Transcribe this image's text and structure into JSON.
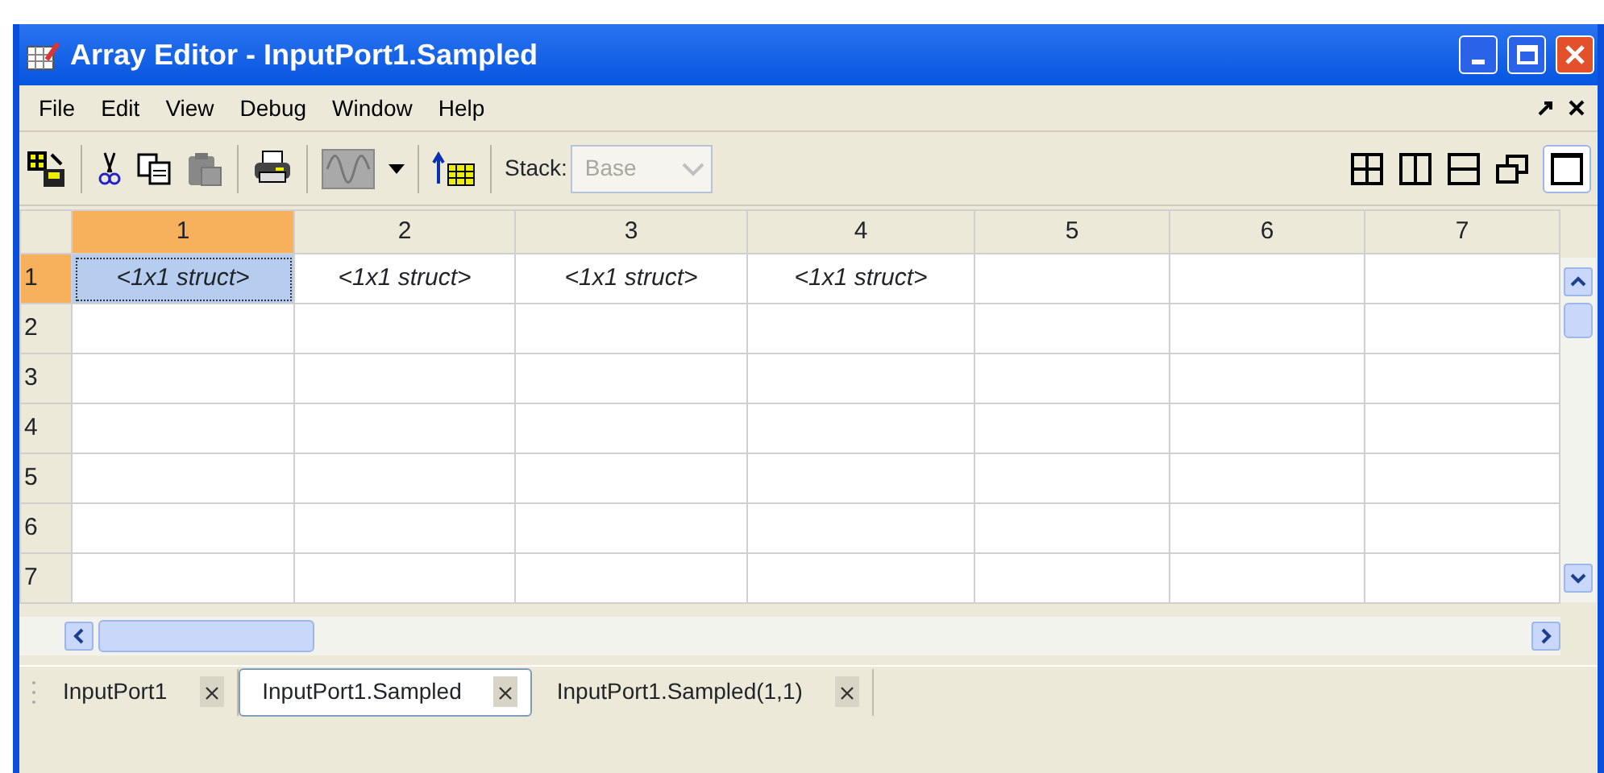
{
  "window": {
    "title": "Array Editor - InputPort1.Sampled"
  },
  "menu": [
    "File",
    "Edit",
    "View",
    "Debug",
    "Window",
    "Help"
  ],
  "toolbar": {
    "stack_label": "Stack:",
    "stack_value": "Base",
    "stack_disabled": true
  },
  "table": {
    "columns": [
      "1",
      "2",
      "3",
      "4",
      "5",
      "6",
      "7"
    ],
    "rows": [
      {
        "header": "1",
        "cells": [
          {
            "text": "<1x1 struct>",
            "selected": true
          },
          {
            "text": "<1x1 struct>",
            "selected": false
          },
          {
            "text": "<1x1 struct>",
            "selected": false
          },
          {
            "text": "<1x1 struct>",
            "selected": false
          },
          {
            "text": "",
            "selected": false
          },
          {
            "text": "",
            "selected": false
          },
          {
            "text": "",
            "selected": false
          }
        ]
      },
      {
        "header": "2"
      },
      {
        "header": "3"
      },
      {
        "header": "4"
      },
      {
        "header": "5"
      },
      {
        "header": "6"
      },
      {
        "header": "7"
      }
    ]
  },
  "tabs": [
    {
      "label": "InputPort1",
      "selected": false
    },
    {
      "label": "InputPort1.Sampled",
      "selected": true
    },
    {
      "label": "InputPort1.Sampled(1,1)",
      "selected": false
    }
  ]
}
